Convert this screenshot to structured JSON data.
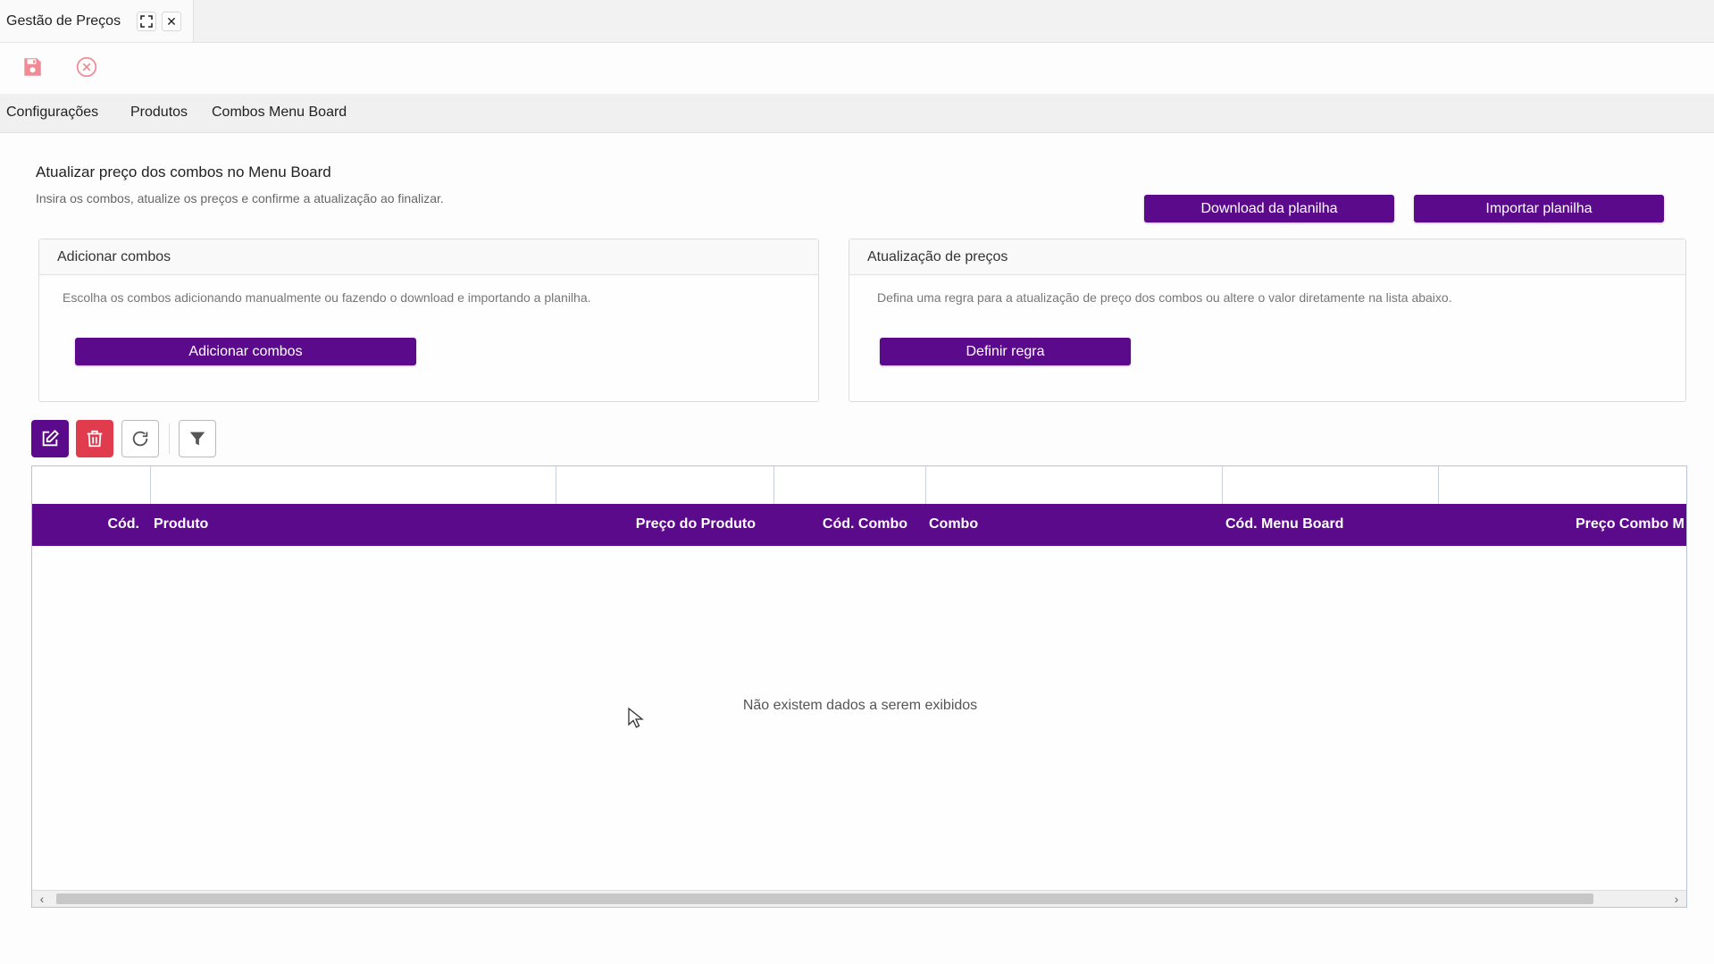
{
  "tab": {
    "title": "Gestão de Preços",
    "expand_icon": "expand-icon",
    "close_icon": "close-icon",
    "close_glyph": "✕"
  },
  "toolbar": {
    "save_icon": "save-icon",
    "cancel_icon": "cancel-icon"
  },
  "nav": {
    "items": [
      "Configurações",
      "Produtos",
      "Combos Menu Board"
    ]
  },
  "page": {
    "title": "Atualizar preço dos combos no Menu Board",
    "subtitle": "Insira os combos, atualize os preços e confirme a atualização ao finalizar.",
    "download_label": "Download da planilha",
    "import_label": "Importar planilha"
  },
  "cards": {
    "add": {
      "title": "Adicionar combos",
      "text": "Escolha os combos adicionando manualmente ou fazendo o download e importando a planilha.",
      "button": "Adicionar combos"
    },
    "price": {
      "title": "Atualização de preços",
      "text": "Defina uma regra para a atualização de preço dos combos ou altere o valor diretamente na lista abaixo.",
      "button": "Definir regra"
    }
  },
  "actions": {
    "edit_icon": "edit-icon",
    "delete_icon": "trash-icon",
    "refresh_icon": "refresh-icon",
    "filter_icon": "filter-icon"
  },
  "grid": {
    "columns": [
      "Cód.",
      "Produto",
      "Preço do Produto",
      "Cód. Combo",
      "Combo",
      "Cód. Menu Board",
      "Preço Combo M"
    ],
    "empty_message": "Não existem dados a serem exibidos",
    "scroll_left": "‹",
    "scroll_right": "›"
  },
  "colors": {
    "accent": "#5c0a8c",
    "danger": "#e03c4e"
  }
}
